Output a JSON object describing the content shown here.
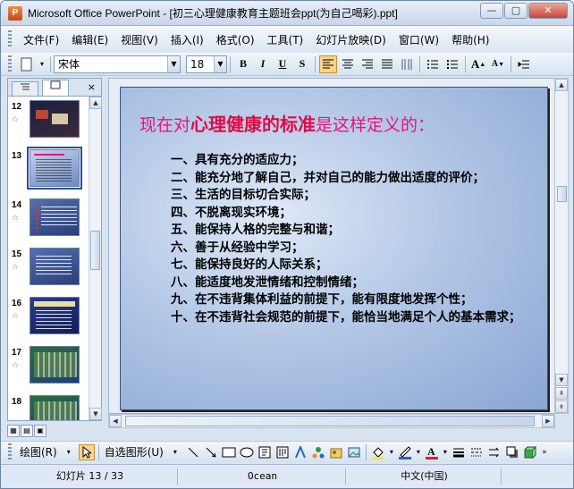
{
  "window": {
    "app_name": "Microsoft Office PowerPoint",
    "title": "Microsoft Office PowerPoint - [初三心理健康教育主题班会ppt(为自己喝彩).ppt]",
    "buttons": {
      "minimize": "—",
      "maximize": "▢",
      "close": "✕"
    }
  },
  "menu": {
    "items": [
      "文件(F)",
      "编辑(E)",
      "视图(V)",
      "插入(I)",
      "格式(O)",
      "工具(T)",
      "幻灯片放映(D)",
      "窗口(W)",
      "帮助(H)"
    ]
  },
  "toolbar": {
    "font_name": "宋体",
    "font_size": "18",
    "bold": "B",
    "italic": "I",
    "underline": "U",
    "shadow": "S",
    "align_left_active": true
  },
  "left_pane": {
    "tabs": [
      "outline-tab",
      "slides-tab"
    ],
    "close": "×",
    "thumbnails": [
      {
        "num": "12",
        "selected": false
      },
      {
        "num": "13",
        "selected": true
      },
      {
        "num": "14",
        "selected": false
      },
      {
        "num": "15",
        "selected": false
      },
      {
        "num": "16",
        "selected": false
      },
      {
        "num": "17",
        "selected": false
      },
      {
        "num": "18",
        "selected": false
      }
    ],
    "star": "☆"
  },
  "slide": {
    "title_prefix": "现在对",
    "title_highlight": "心理健康的标准",
    "title_suffix": "是这样定义的：",
    "lines": [
      "一、具有充分的适应力；",
      "二、能充分地了解自己，并对自己的能力做出适度的评价；",
      "三、生活的目标切合实际；",
      "四、不脱离现实环境；",
      "五、能保持人格的完整与和谐；",
      "六、善于从经验中学习；",
      "七、能保持良好的人际关系；",
      "八、能适度地发泄情绪和控制情绪；",
      "九、在不违背集体利益的前提下，能有限度地发挥个性；",
      "十、在不违背社会规范的前提下，能恰当地满足个人的基本需求；"
    ]
  },
  "drawing_toolbar": {
    "draw_label": "绘图(R)",
    "autoshapes_label": "自选图形(U)"
  },
  "status": {
    "slide_info": "幻灯片 13 / 33",
    "design": "Ocean",
    "language": "中文(中国)"
  }
}
